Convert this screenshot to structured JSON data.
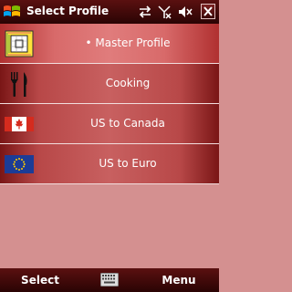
{
  "title": "Select Profile",
  "status_icons": [
    "sync-icon",
    "no-signal-icon",
    "volume-icon",
    "close-icon"
  ],
  "profiles": [
    {
      "label": "• Master Profile",
      "icon": "ruler-grid-icon",
      "selected": true
    },
    {
      "label": "Cooking",
      "icon": "fork-knife-icon"
    },
    {
      "label": "US to Canada",
      "icon": "canada-flag-icon"
    },
    {
      "label": "US to Euro",
      "icon": "eu-flag-icon"
    }
  ],
  "softkeys": {
    "left": "Select",
    "right": "Menu"
  },
  "colors": {
    "bar": "#3a0606",
    "row": "#b84848",
    "selected_row": "#d86a6a",
    "background": "#d49090"
  }
}
